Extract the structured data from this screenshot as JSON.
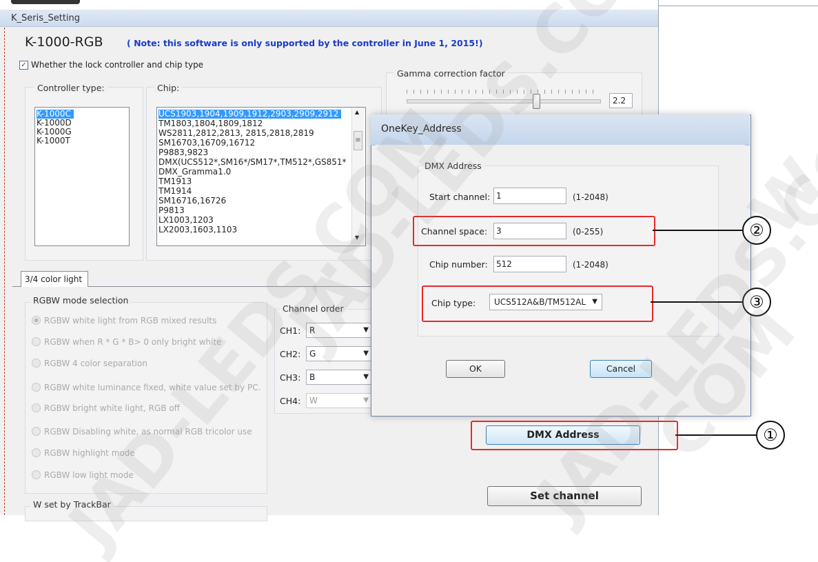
{
  "window": {
    "title": "K_Seris_Setting",
    "model": "K-1000-RGB",
    "note": "( Note: this software is only supported by the controller in June 1, 2015!)",
    "lock_checked": "✓",
    "lock_label": "Whether the lock controller and chip type"
  },
  "controller": {
    "label": "Controller type:",
    "items": [
      "K-1000C",
      "K-1000D",
      "K-1000G",
      "K-1000T"
    ],
    "selected_index": 0
  },
  "chip": {
    "label": "Chip:",
    "items": [
      "UCS1903,1904,1909,1912,2903,2909,2912",
      "TM1803,1804,1809,1812",
      "WS2811,2812,2813, 2815,2818,2819",
      "SM16703,16709,16712",
      "P9883,9823",
      "DMX(UCS512*,SM16*/SM17*,TM512*,GS851*",
      "DMX_Gramma1.0",
      "TM1913",
      "TM1914",
      "SM16716,16726",
      "P9813",
      "LX1003,1203",
      "LX2003,1603,1103"
    ],
    "selected_index": 0
  },
  "gamma": {
    "label": "Gamma correction factor",
    "value": "2.2"
  },
  "tabs": {
    "color_light": "3/4 color light"
  },
  "rgbw": {
    "label": "RGBW mode selection",
    "options": [
      "RGBW white light from RGB mixed results",
      "RGBW when R * G * B> 0 only bright white",
      "RGBW 4 color separation",
      "RGBW white luminance fixed, white value set by PC.",
      "RGBW bright white light, RGB off",
      "RGBW Disabling white, as normal RGB tricolor use",
      "RGBW highlight mode",
      "RGBW low light mode"
    ],
    "selected_index": 0
  },
  "channel_order": {
    "label": "Channel order",
    "channels": [
      {
        "name": "CH1:",
        "value": "R"
      },
      {
        "name": "CH2:",
        "value": "G"
      },
      {
        "name": "CH3:",
        "value": "B"
      },
      {
        "name": "CH4:",
        "value": "W"
      }
    ]
  },
  "wset": {
    "label": "W set by TrackBar"
  },
  "buttons": {
    "dmx_address": "DMX Address",
    "set_channel": "Set channel"
  },
  "dialog": {
    "title": "OneKey_Address",
    "group_label": "DMX Address",
    "start_channel_label": "Start channel:",
    "start_channel_value": "1",
    "start_channel_range": "(1-2048)",
    "channel_space_label": "Channel space:",
    "channel_space_value": "3",
    "channel_space_range": "(0-255)",
    "chip_number_label": "Chip number:",
    "chip_number_value": "512",
    "chip_number_range": "(1-2048)",
    "chip_type_label": "Chip type:",
    "chip_type_value": "UCS512A&B/TM512AL",
    "ok": "OK",
    "cancel": "Cancel"
  },
  "annotations": {
    "one": "①",
    "two": "②",
    "three": "③"
  },
  "watermarks": [
    "JAD-LEDS.COM",
    "JAD-LEDS.COM",
    "JAD-LEDS.COM",
    "COM",
    "W"
  ],
  "colors": {
    "note_blue": "#1a3cc8",
    "selection_blue": "#3399ff",
    "highlight_red": "#e8272a"
  },
  "icons": {
    "dropdown": "▼",
    "scroll_up": "▲",
    "scroll_down": "▼",
    "scroll_grip": "≡"
  }
}
